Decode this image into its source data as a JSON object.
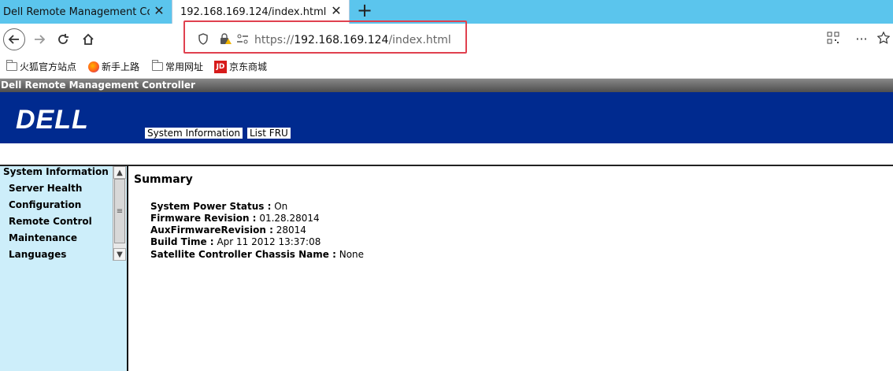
{
  "browser": {
    "tabs": [
      {
        "title": "Dell Remote Management Contr",
        "active": false
      },
      {
        "title": "192.168.169.124/index.html",
        "active": true
      }
    ],
    "url": {
      "scheme": "https://",
      "host": "192.168.169.124",
      "path": "/index.html"
    },
    "bookmarks": [
      {
        "label": "火狐官方站点",
        "icon": "folder-icon"
      },
      {
        "label": "新手上路",
        "icon": "firefox-icon"
      },
      {
        "label": "常用网址",
        "icon": "folder-icon"
      },
      {
        "label": "京东商城",
        "icon": "jd-icon"
      }
    ],
    "accent_color": "#5bc5ed",
    "highlight_color": "#e0414f"
  },
  "page": {
    "app_title": "Dell Remote Management Controller",
    "logo_text": "DELL",
    "top_nav": [
      "System Information",
      "List FRU"
    ],
    "left_nav": {
      "header": "System Information",
      "items": [
        "Server Health",
        "Configuration",
        "Remote Control",
        "Maintenance",
        "Languages"
      ]
    },
    "summary": {
      "title": "Summary",
      "fields": [
        {
          "label": "System Power Status :",
          "value": "On"
        },
        {
          "label": "Firmware Revision :",
          "value": "01.28.28014"
        },
        {
          "label": "AuxFirmwareRevision :",
          "value": "28014"
        },
        {
          "label": "Build Time :",
          "value": "Apr 11 2012 13:37:08"
        },
        {
          "label": "Satellite Controller Chassis Name :",
          "value": "None"
        }
      ]
    },
    "colors": {
      "banner": "#002a8f",
      "left_panel": "#cdeefa"
    }
  }
}
